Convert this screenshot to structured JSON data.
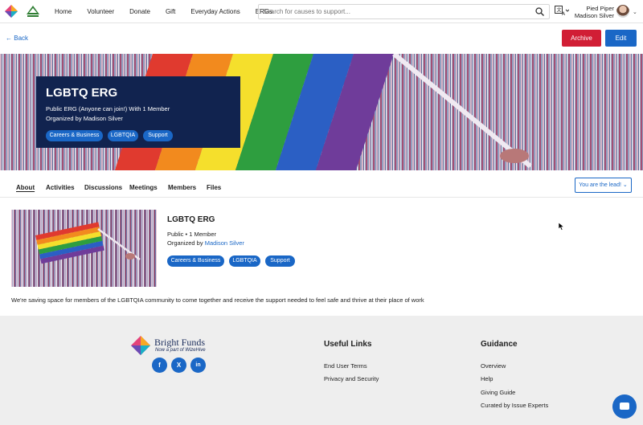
{
  "nav": {
    "links": [
      "Home",
      "Volunteer",
      "Donate",
      "Gift",
      "Everyday Actions",
      "ERGs"
    ],
    "search_placeholder": "Search for causes to support...",
    "company": "Pied Piper",
    "user": "Madison Silver"
  },
  "actions": {
    "back": "Back",
    "archive": "Archive",
    "edit": "Edit"
  },
  "hero": {
    "title": "LGBTQ ERG",
    "subtitle": "Public ERG (Anyone can join!) With 1 Member",
    "organizer": "Organized by Madison Silver",
    "tags": [
      "Careers & Business",
      "LGBTQIA",
      "Support"
    ]
  },
  "tabs": {
    "items": [
      "About",
      "Activities",
      "Discussions",
      "Meetings",
      "Members",
      "Files"
    ],
    "active": "About",
    "lead_button": "You are the lead!"
  },
  "about": {
    "title": "LGBTQ ERG",
    "meta": "Public • 1 Member",
    "organized_prefix": "Organized by",
    "organizer_name": "Madison Silver",
    "tags": [
      "Careers & Business",
      "LGBTQIA",
      "Support"
    ],
    "description": "We're saving space for members of the LGBTQIA community to come together and receive the support needed to feel safe and thrive at their place of work"
  },
  "footer": {
    "brand_name": "Bright Funds",
    "brand_tagline": "Now a part of WizeHive",
    "social": [
      "f",
      "X",
      "in"
    ],
    "useful_links_heading": "Useful Links",
    "useful_links": [
      "End User Terms",
      "Privacy and Security"
    ],
    "guidance_heading": "Guidance",
    "guidance_links": [
      "Overview",
      "Help",
      "Giving Guide",
      "Curated by Issue Experts"
    ]
  },
  "colors": {
    "primary": "#1a67c6",
    "danger": "#d11e35",
    "hero_card": "#11234f",
    "footer_bg": "#eeeeee"
  }
}
